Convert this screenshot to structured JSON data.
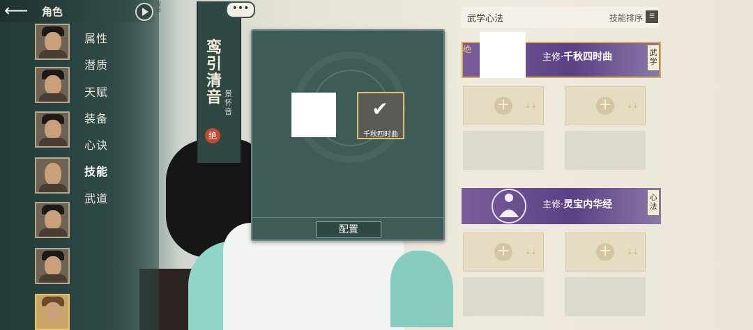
{
  "header": {
    "title": "角色",
    "tutorial_label": "教学"
  },
  "characters": [
    {
      "name": "char-1"
    },
    {
      "name": "char-2"
    },
    {
      "name": "char-3"
    },
    {
      "name": "char-4"
    },
    {
      "name": "char-5"
    },
    {
      "name": "char-6"
    },
    {
      "name": "char-7-active"
    }
  ],
  "menu": [
    "属性",
    "潜质",
    "天赋",
    "装备",
    "心诀",
    "技能",
    "武道"
  ],
  "menu_active": "技能",
  "banner": {
    "title": "鸾引清音",
    "subtitle": "景怀音",
    "badge": "绝",
    "chat": "•••"
  },
  "modal": {
    "selected_skill": "千秋四时曲",
    "config_button": "配置"
  },
  "right_panel": {
    "title": "武学心法",
    "sort_label": "技能排序",
    "sort_icon": "sort-icon",
    "martial_card": {
      "tag": "绝",
      "prefix": "主修·",
      "name": "千秋四时曲",
      "side_tag": "武学"
    },
    "inner_card": {
      "prefix": "主修·",
      "name": "灵宝内华经",
      "side_tag": "心法"
    }
  },
  "colors": {
    "accent_gold": "#e3c070",
    "card_purple": "#5b4183",
    "panel_dark": "#2c4744"
  }
}
